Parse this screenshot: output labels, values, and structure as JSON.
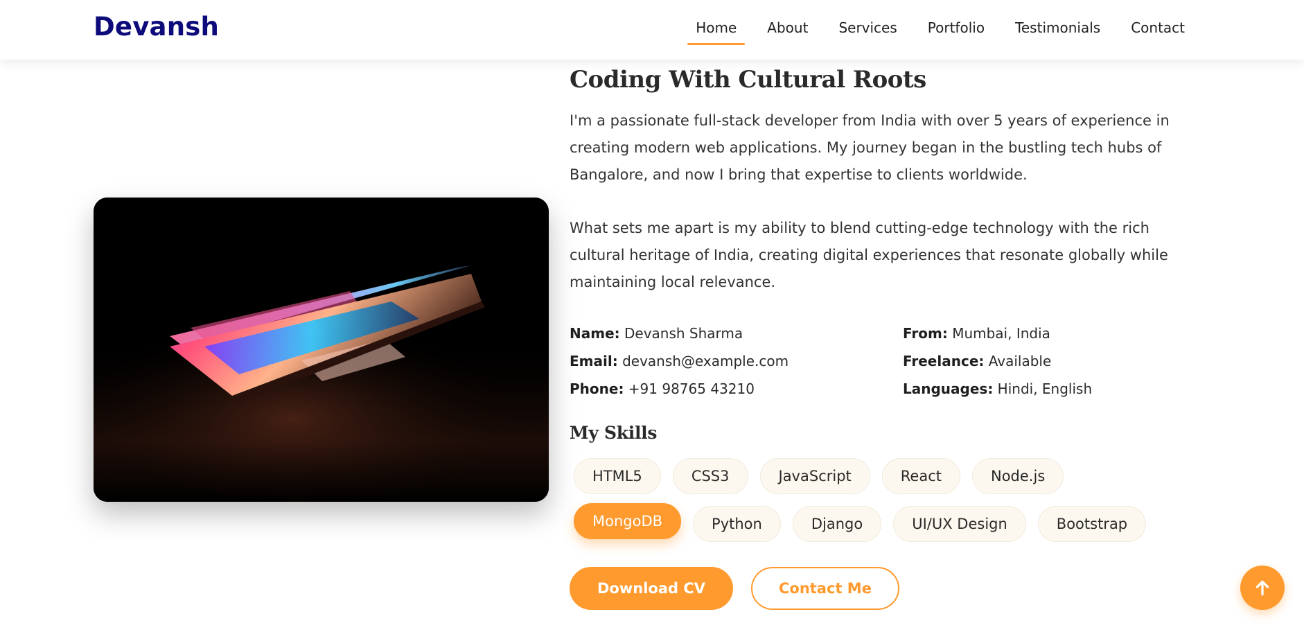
{
  "brand": "Devansh",
  "nav": {
    "items": [
      {
        "label": "Home",
        "active": true
      },
      {
        "label": "About",
        "active": false
      },
      {
        "label": "Services",
        "active": false
      },
      {
        "label": "Portfolio",
        "active": false
      },
      {
        "label": "Testimonials",
        "active": false
      },
      {
        "label": "Contact",
        "active": false
      }
    ]
  },
  "about": {
    "heading": "Coding With Cultural Roots",
    "paragraphs": [
      "I'm a passionate full-stack developer from India with over 5 years of experience in creating modern web applications. My journey began in the bustling tech hubs of Bangalore, and now I bring that expertise to clients worldwide.",
      "What sets me apart is my ability to blend cutting-edge technology with the rich cultural heritage of India, creating digital experiences that resonate globally while maintaining local relevance."
    ],
    "info": [
      {
        "label": "Name:",
        "value": "Devansh Sharma"
      },
      {
        "label": "From:",
        "value": "Mumbai, India"
      },
      {
        "label": "Email:",
        "value": "devansh@example.com"
      },
      {
        "label": "Freelance:",
        "value": "Available"
      },
      {
        "label": "Phone:",
        "value": "+91 98765 43210"
      },
      {
        "label": "Languages:",
        "value": "Hindi, English"
      }
    ],
    "skills_title": "My Skills",
    "skills": [
      "HTML5",
      "CSS3",
      "JavaScript",
      "React",
      "Node.js",
      "MongoDB",
      "Python",
      "Django",
      "UI/UX Design",
      "Bootstrap"
    ],
    "highlighted_skill": "MongoDB",
    "buttons": {
      "download": "Download CV",
      "contact": "Contact Me"
    }
  },
  "icons": {
    "back_to_top": "arrow-up-icon"
  },
  "colors": {
    "accent": "#ff9a2e",
    "brand": "#0d0a7a"
  }
}
